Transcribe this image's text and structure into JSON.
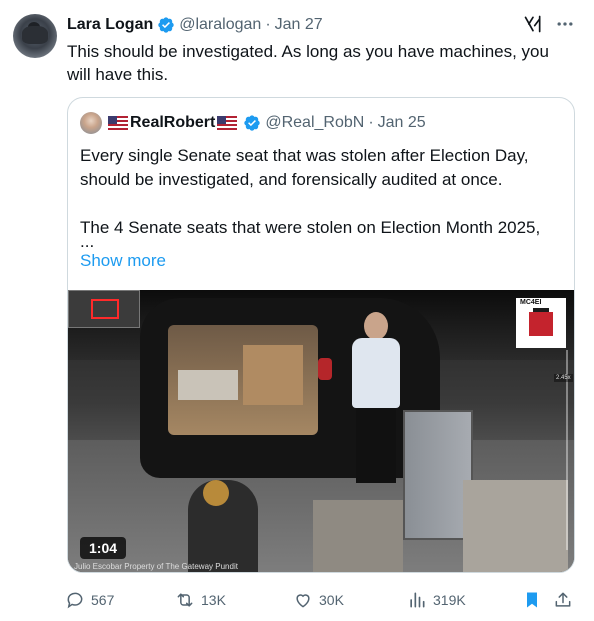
{
  "author": {
    "name": "Lara Logan",
    "handle": "@laralogan",
    "separator": "·",
    "date": "Jan 27",
    "verified_icon": "verified-badge-icon",
    "avatar_icon": "avatar"
  },
  "tweet_text": "This should be investigated. As long as you have machines, you will have this.",
  "quoted": {
    "name": "RealRobert",
    "handle": "@Real_RobN",
    "separator": "·",
    "date": "Jan 25",
    "paragraph1": "Every single Senate seat that was stolen  after Election Day, should be investigated, and forensically audited at once.",
    "paragraph2": "The 4 Senate seats that were stolen on Election Month 2025,",
    "ellipsis": "...",
    "show_more": "Show more",
    "video": {
      "duration": "1:04",
      "logo_text": "MC4EI",
      "zoom_label": "2.45x",
      "credit": "Julio Escobar Property of The Gateway Pundit"
    }
  },
  "actions": {
    "reply_count": "567",
    "repost_count": "13K",
    "like_count": "30K",
    "views_count": "319K"
  },
  "colors": {
    "link": "#1d9bf0",
    "muted": "#536471",
    "text": "#0f1419",
    "border": "#cfd9de"
  }
}
